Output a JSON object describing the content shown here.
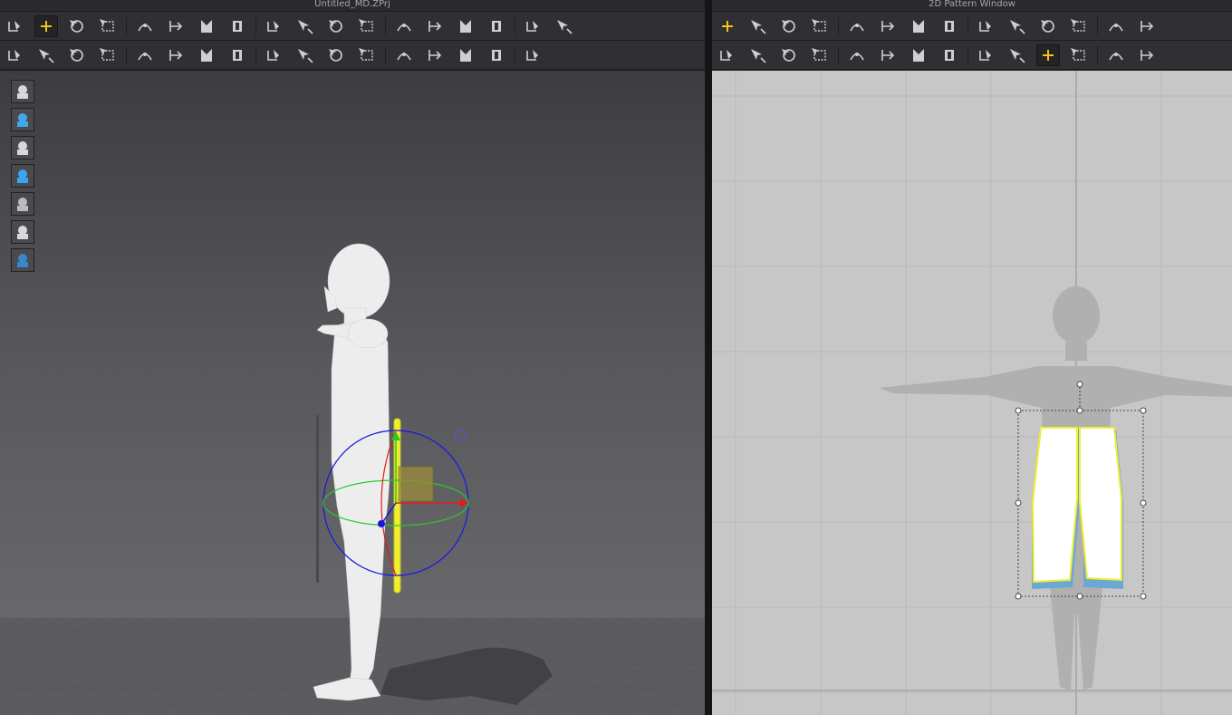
{
  "window_left": {
    "title": "Untitled_MD.ZPrj"
  },
  "window_right": {
    "title": "2D Pattern Window"
  },
  "toolbar_3d_row1": [
    "download-arrow-icon",
    "select-move-icon",
    "edit-point-icon",
    "transform-icon",
    "fold-icon",
    "sew-segment-icon",
    "sew-free-icon",
    "sew-multi-icon",
    "pin-line-icon",
    "fabric-drape-icon",
    "garment-icon",
    "tack-icon",
    "tack-multi-icon",
    "shirt-icon",
    "arrange-front-icon",
    "arrange-side-icon",
    "grid-layout-icon",
    "grid-layout-2-icon"
  ],
  "toolbar_3d_row2": [
    "avatar-walk-icon",
    "edit-segment-icon",
    "edit-point-alt-icon",
    "trace-icon",
    "cut-icon",
    "shirt-cut-icon",
    "fold-3d-icon",
    "fold-arrange-icon",
    "fold-multi-icon",
    "button-icon",
    "button-round-icon",
    "line-tool-icon",
    "lock-icon",
    "zipper-icon",
    "strap-icon",
    "tape-icon",
    "measure-icon"
  ],
  "toolbar_2d_row1": [
    "select-pattern-icon",
    "edit-point-2d-icon",
    "curve-point-icon",
    "curvature-icon",
    "add-point-icon",
    "cut-line-icon",
    "rectangle-pattern-icon",
    "polygon-pattern-icon",
    "trace-pattern-icon",
    "pattern-paste-icon",
    "ruler-stripes-icon",
    "arrange-2d-icon",
    "grid-2d-icon",
    "grid-2d-alt-icon"
  ],
  "toolbar_2d_row2": [
    "sew-2d-icon",
    "sew-free-2d-icon",
    "sew-multi-2d-icon",
    "sew-check-icon",
    "sew-check-2d-icon",
    "iron-icon",
    "garment-2d-icon",
    "fold-2d-icon",
    "fold-arrange-2d-icon",
    "shirt-2d-icon",
    "pin-pattern-icon",
    "line-2d-icon",
    "dashed-line-icon",
    "curve-line-icon"
  ],
  "side_tools": [
    "garment-display-icon",
    "particle-icon",
    "avatar-display-icon",
    "texture-icon",
    "surface-icon",
    "avatar-head-icon",
    "globe-icon"
  ],
  "colors": {
    "accent": "#f2c417",
    "gizmo_x": "#e21b1b",
    "gizmo_y": "#2ac92a",
    "gizmo_z": "#1717e6",
    "pattern_outline": "#f1ed2f",
    "pattern_shadow": "#6aa9d3"
  }
}
